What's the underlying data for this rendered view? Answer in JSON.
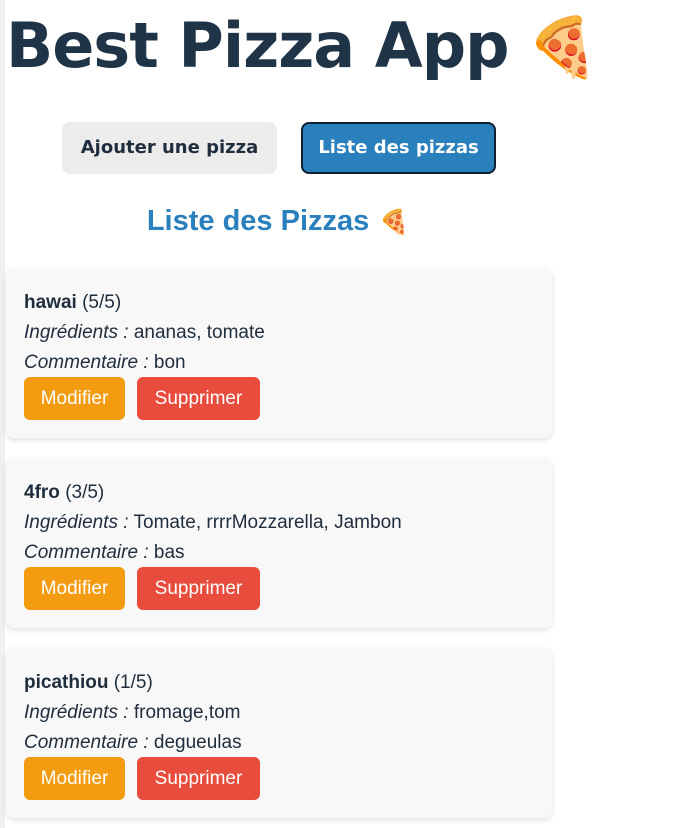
{
  "app": {
    "title": "Best Pizza App",
    "title_emoji": "🍕"
  },
  "nav": {
    "add_label": "Ajouter une pizza",
    "list_label": "Liste des pizzas",
    "active_tab": "list"
  },
  "section": {
    "title": "Liste des Pizzas",
    "title_emoji": "🍕"
  },
  "field_labels": {
    "ingredients": "Ingrédients :",
    "comment": "Commentaire :"
  },
  "actions": {
    "edit_label": "Modifier",
    "delete_label": "Supprimer"
  },
  "pizzas": [
    {
      "name": "hawai",
      "rating": "(5/5)",
      "ingredients": "ananas, tomate",
      "comment": "bon"
    },
    {
      "name": "4fro",
      "rating": "(3/5)",
      "ingredients": "Tomate, rrrrMozzarella, Jambon",
      "comment": "bas"
    },
    {
      "name": "picathiou",
      "rating": "(1/5)",
      "ingredients": "fromage,tom",
      "comment": "degueulas"
    }
  ],
  "colors": {
    "title": "#1f3447",
    "accent_blue": "#2a7fbd",
    "edit_orange": "#f39c12",
    "delete_red": "#e74c3c",
    "card_bg": "#f8f8f8"
  }
}
